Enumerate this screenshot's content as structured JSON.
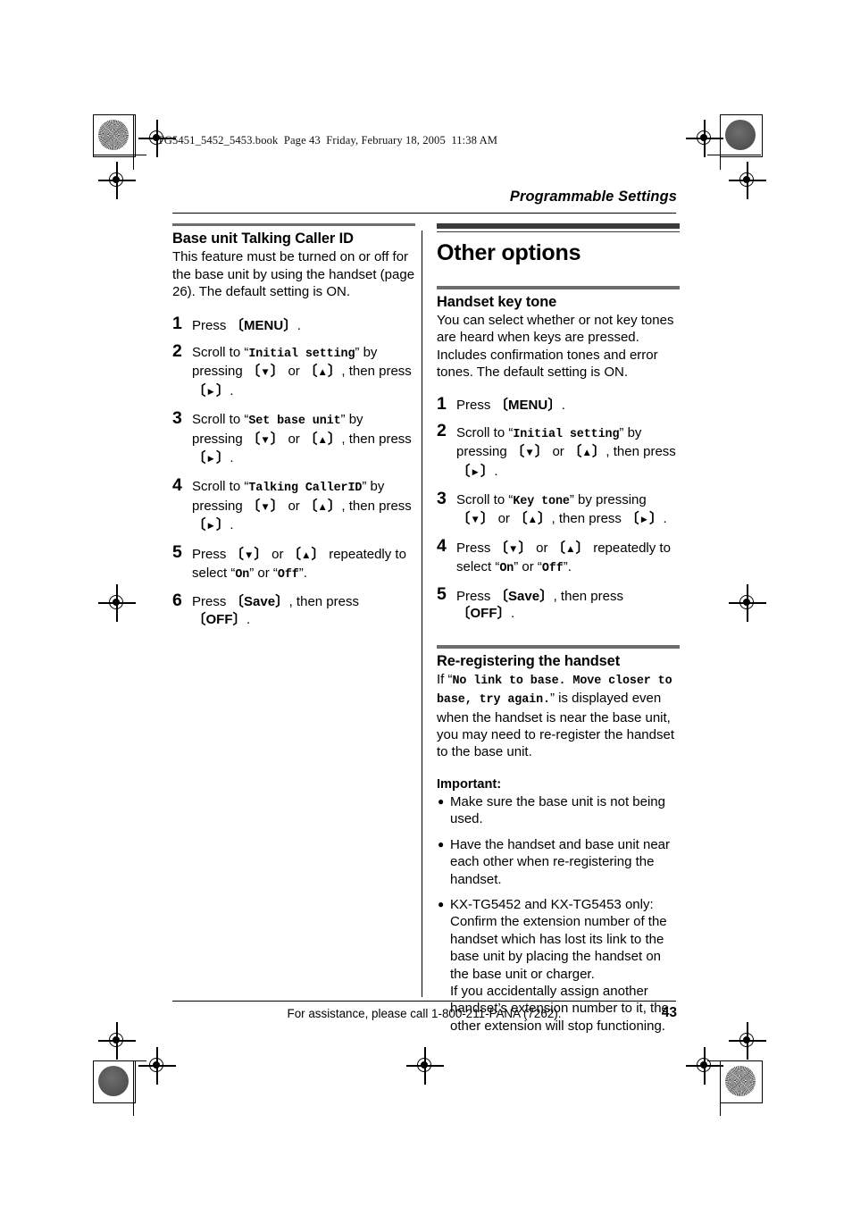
{
  "print_marks": {
    "book_line": "TG5451_5452_5453.book  Page 43  Friday, February 18, 2005  11:38 AM"
  },
  "running_head": {
    "title": "Programmable Settings"
  },
  "left_column": {
    "heading": "Base unit Talking Caller ID",
    "intro": "This feature must be turned on or off for the base unit by using the handset (page 26). The default setting is ON.",
    "steps": [
      {
        "num": "1",
        "parts": [
          {
            "t": "text",
            "v": "Press "
          },
          {
            "t": "key",
            "v": "MENU"
          },
          {
            "t": "text",
            "v": "."
          }
        ]
      },
      {
        "num": "2",
        "parts": [
          {
            "t": "text",
            "v": "Scroll to “"
          },
          {
            "t": "mono",
            "v": "Initial setting"
          },
          {
            "t": "text",
            "v": "” by pressing "
          },
          {
            "t": "key-down",
            "v": ""
          },
          {
            "t": "text",
            "v": " or "
          },
          {
            "t": "key-up",
            "v": ""
          },
          {
            "t": "text",
            "v": ", then press "
          },
          {
            "t": "key-right",
            "v": ""
          },
          {
            "t": "text",
            "v": "."
          }
        ]
      },
      {
        "num": "3",
        "parts": [
          {
            "t": "text",
            "v": "Scroll to “"
          },
          {
            "t": "mono",
            "v": "Set base unit"
          },
          {
            "t": "text",
            "v": "” by pressing "
          },
          {
            "t": "key-down",
            "v": ""
          },
          {
            "t": "text",
            "v": " or "
          },
          {
            "t": "key-up",
            "v": ""
          },
          {
            "t": "text",
            "v": ", then press "
          },
          {
            "t": "key-right",
            "v": ""
          },
          {
            "t": "text",
            "v": "."
          }
        ]
      },
      {
        "num": "4",
        "parts": [
          {
            "t": "text",
            "v": "Scroll to “"
          },
          {
            "t": "mono",
            "v": "Talking CallerID"
          },
          {
            "t": "text",
            "v": "” by pressing "
          },
          {
            "t": "key-down",
            "v": ""
          },
          {
            "t": "text",
            "v": " or "
          },
          {
            "t": "key-up",
            "v": ""
          },
          {
            "t": "text",
            "v": ", then press "
          },
          {
            "t": "key-right",
            "v": ""
          },
          {
            "t": "text",
            "v": "."
          }
        ]
      },
      {
        "num": "5",
        "parts": [
          {
            "t": "text",
            "v": "Press "
          },
          {
            "t": "key-down",
            "v": ""
          },
          {
            "t": "text",
            "v": " or "
          },
          {
            "t": "key-up",
            "v": ""
          },
          {
            "t": "text",
            "v": " repeatedly to select “"
          },
          {
            "t": "mono",
            "v": "On"
          },
          {
            "t": "text",
            "v": "” or “"
          },
          {
            "t": "mono",
            "v": "Off"
          },
          {
            "t": "text",
            "v": "”."
          }
        ]
      },
      {
        "num": "6",
        "parts": [
          {
            "t": "text",
            "v": "Press "
          },
          {
            "t": "key",
            "v": "Save"
          },
          {
            "t": "text",
            "v": ", then press "
          },
          {
            "t": "key",
            "v": "OFF"
          },
          {
            "t": "text",
            "v": "."
          }
        ]
      }
    ]
  },
  "right_column": {
    "section_heading": "Other options",
    "key_tone": {
      "heading": "Handset key tone",
      "intro": "You can select whether or not key tones are heard when keys are pressed. Includes confirmation tones and error tones. The default setting is ON.",
      "steps": [
        {
          "num": "1",
          "parts": [
            {
              "t": "text",
              "v": "Press "
            },
            {
              "t": "key",
              "v": "MENU"
            },
            {
              "t": "text",
              "v": "."
            }
          ]
        },
        {
          "num": "2",
          "parts": [
            {
              "t": "text",
              "v": "Scroll to “"
            },
            {
              "t": "mono",
              "v": "Initial setting"
            },
            {
              "t": "text",
              "v": "” by pressing "
            },
            {
              "t": "key-down",
              "v": ""
            },
            {
              "t": "text",
              "v": " or "
            },
            {
              "t": "key-up",
              "v": ""
            },
            {
              "t": "text",
              "v": ", then press "
            },
            {
              "t": "key-right",
              "v": ""
            },
            {
              "t": "text",
              "v": "."
            }
          ]
        },
        {
          "num": "3",
          "parts": [
            {
              "t": "text",
              "v": "Scroll to “"
            },
            {
              "t": "mono",
              "v": "Key tone"
            },
            {
              "t": "text",
              "v": "” by pressing "
            },
            {
              "t": "key-down",
              "v": ""
            },
            {
              "t": "text",
              "v": " or "
            },
            {
              "t": "key-up",
              "v": ""
            },
            {
              "t": "text",
              "v": ", then press "
            },
            {
              "t": "key-right",
              "v": ""
            },
            {
              "t": "text",
              "v": "."
            }
          ]
        },
        {
          "num": "4",
          "parts": [
            {
              "t": "text",
              "v": "Press "
            },
            {
              "t": "key-down",
              "v": ""
            },
            {
              "t": "text",
              "v": " or "
            },
            {
              "t": "key-up",
              "v": ""
            },
            {
              "t": "text",
              "v": " repeatedly to select “"
            },
            {
              "t": "mono",
              "v": "On"
            },
            {
              "t": "text",
              "v": "” or “"
            },
            {
              "t": "mono",
              "v": "Off"
            },
            {
              "t": "text",
              "v": "”."
            }
          ]
        },
        {
          "num": "5",
          "parts": [
            {
              "t": "text",
              "v": "Press "
            },
            {
              "t": "key",
              "v": "Save"
            },
            {
              "t": "text",
              "v": ", then press "
            },
            {
              "t": "key",
              "v": "OFF"
            },
            {
              "t": "text",
              "v": "."
            }
          ]
        }
      ]
    },
    "re_register": {
      "heading": "Re-registering the handset",
      "intro_parts": [
        {
          "t": "text",
          "v": "If “"
        },
        {
          "t": "mono",
          "v": "No link to base. Move closer to base, try again."
        },
        {
          "t": "text",
          "v": "” is displayed even when the handset is near the base unit, you may need to re-register the handset to the base unit."
        }
      ],
      "important_label": "Important:",
      "bullets": [
        "Make sure the base unit is not being used.",
        "Have the handset and base unit near each other when re-registering the handset.",
        "KX-TG5452 and KX-TG5453 only: Confirm the extension number of the handset which has lost its link to the base unit by placing the handset on the base unit or charger.\nIf you accidentally assign another handset’s extension number to it, the other extension will stop functioning."
      ]
    }
  },
  "footer": {
    "assistance": "For assistance, please call 1-800-211-PANA (7262).",
    "page_number": "43"
  },
  "icons": {
    "down": "▼",
    "up": "▲",
    "right": "►",
    "bullet": "●"
  }
}
